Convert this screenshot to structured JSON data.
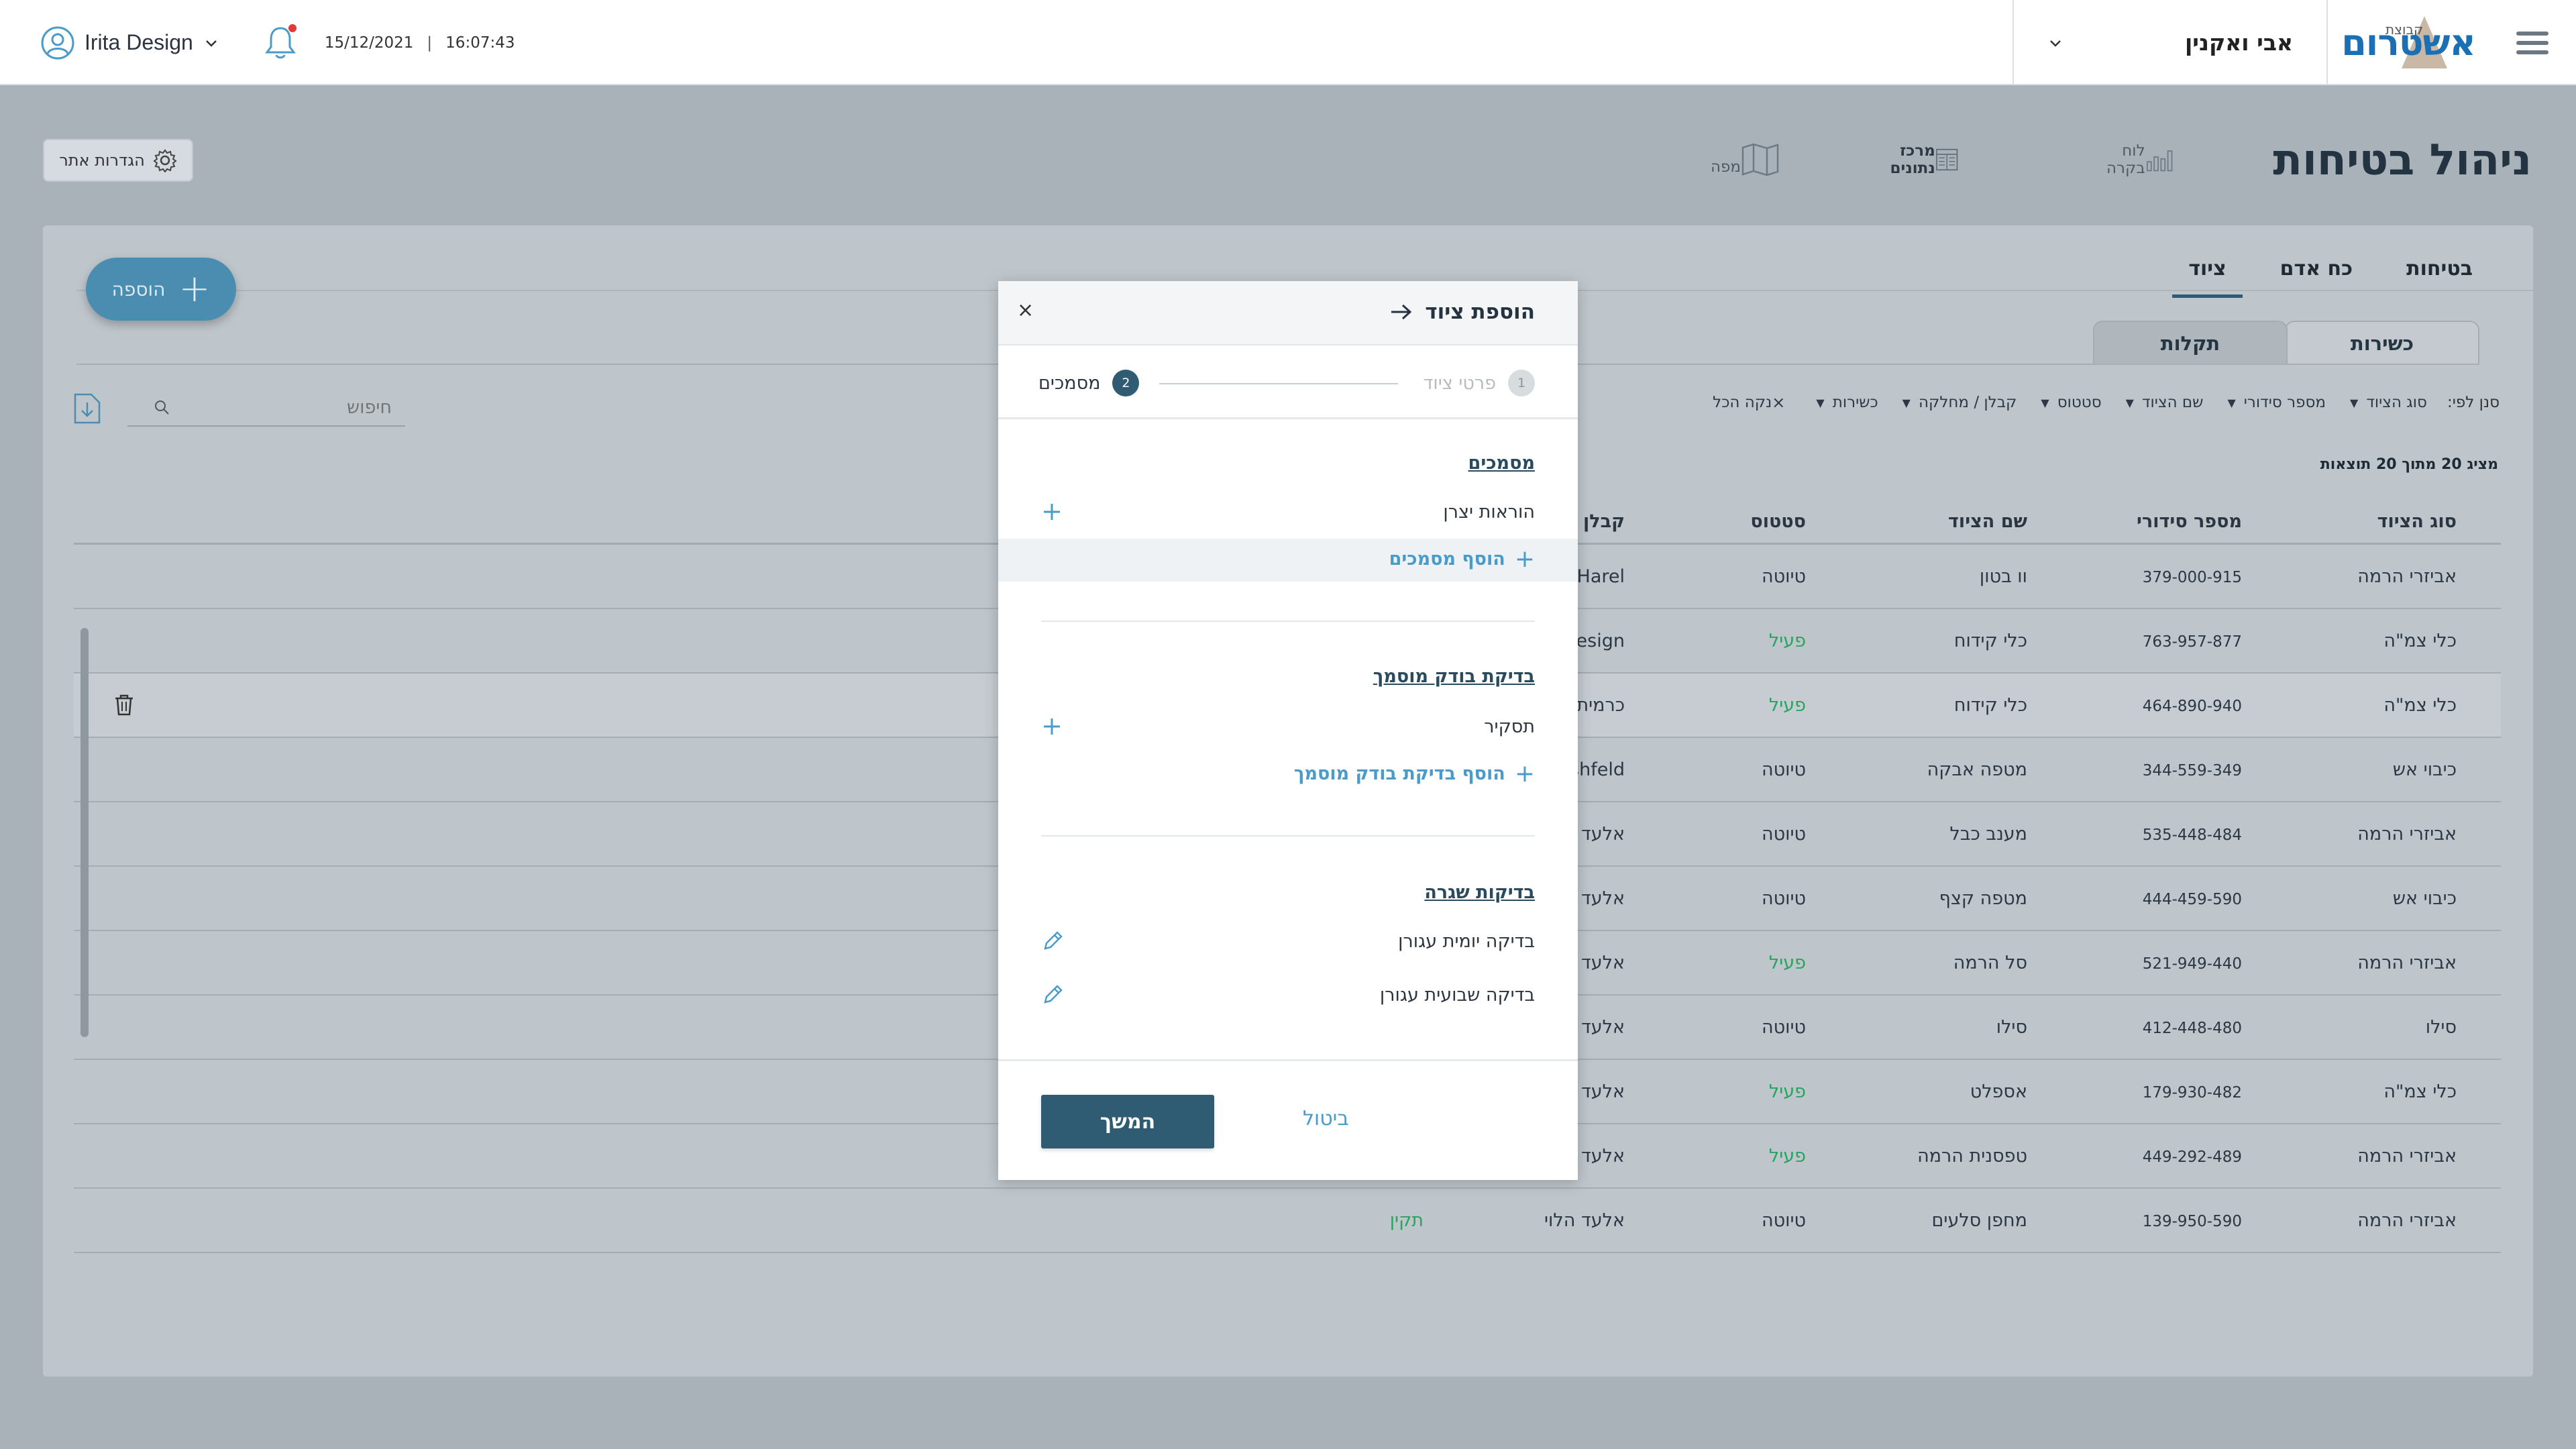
{
  "topbar": {
    "user_name": "Irita Design",
    "date": "15/12/2021",
    "separator": "|",
    "time": "16:07:43",
    "company_name": "אבי ואקנין",
    "logo_small": "קבוצת",
    "logo_text": "אשטרום"
  },
  "page": {
    "title": "ניהול בטיחות",
    "views": {
      "dashboard": "לוח בקרה",
      "data_center": "מרכז נתונים",
      "map": "מפה"
    },
    "site_settings": "הגדרות אתר"
  },
  "tabs": [
    "בטיחות",
    "כח אדם",
    "ציוד"
  ],
  "subtabs": [
    "כשירות",
    "תקלות"
  ],
  "add_button": "הוספה",
  "filter": {
    "label": "סנן לפי:",
    "items": [
      "סוג הציוד",
      "מספר סידורי",
      "שם הציוד",
      "סטטוס",
      "קבלן / מחלקה",
      "כשירות"
    ],
    "clear": "נקה הכל"
  },
  "search": {
    "placeholder": "חיפוש"
  },
  "results_count": "מציג 20 מתוך 20 תוצאות",
  "table": {
    "headers": [
      "סוג הציוד",
      "מספר סידורי",
      "שם הציוד",
      "סטטוס",
      "קבלן / מ"
    ],
    "rows": [
      {
        "type": "אביזרי הרמה",
        "serial": "379-000-915",
        "name": "וו בטון",
        "status": "טיוטה",
        "contractor": "Harel",
        "status_green": false
      },
      {
        "type": "כלי צמ\"ה",
        "serial": "763-957-877",
        "name": "כלי קידוח",
        "status": "פעיל",
        "contractor": "Design",
        "status_green": true
      },
      {
        "type": "כלי צמ\"ה",
        "serial": "464-890-940",
        "name": "כלי קידוח",
        "status": "פעיל",
        "contractor": "כרמית",
        "status_green": true
      },
      {
        "type": "כיבוי אש",
        "serial": "344-559-349",
        "name": "מטפה אבקה",
        "status": "טיוטה",
        "contractor": "shfeld",
        "status_green": false
      },
      {
        "type": "אביזרי הרמה",
        "serial": "535-448-484",
        "name": "מענב כבל",
        "status": "טיוטה",
        "contractor": "אלעד",
        "status_green": false
      },
      {
        "type": "כיבוי אש",
        "serial": "444-459-590",
        "name": "מטפה קצף",
        "status": "טיוטה",
        "contractor": "אלעד",
        "status_green": false
      },
      {
        "type": "אביזרי הרמה",
        "serial": "521-949-440",
        "name": "סל הרמה",
        "status": "פעיל",
        "contractor": "אלעד",
        "status_green": true
      },
      {
        "type": "סילו",
        "serial": "412-448-480",
        "name": "סילו",
        "status": "טיוטה",
        "contractor": "אלעד",
        "status_green": false
      },
      {
        "type": "כלי צמ\"ה",
        "serial": "179-930-482",
        "name": "אספלט",
        "status": "פעיל",
        "contractor": "אלעד",
        "status_green": true
      },
      {
        "type": "אביזרי הרמה",
        "serial": "449-292-489",
        "name": "טפסנית הרמה",
        "status": "פעיל",
        "contractor": "אלעד",
        "status_green": true
      },
      {
        "type": "אביזרי הרמה",
        "serial": "139-950-590",
        "name": "מחפן סלעים",
        "status": "טיוטה",
        "contractor": "אלעד הלוי",
        "status_green": false,
        "extra": "תקין"
      }
    ]
  },
  "modal": {
    "title": "הוספת ציוד",
    "close": "×",
    "step1_num": "1",
    "step1_label": "פרטי ציוד",
    "step2_num": "2",
    "step2_label": "מסמכים",
    "sec_docs": "מסמכים",
    "doc_item": "הוראות יצרן",
    "add_docs": "הוסף מסמכים",
    "sec_inspection": "בדיקת בודק מוסמך",
    "inspection_item": "תסקיר",
    "add_inspection": "הוסף בדיקת בודק מוסמך",
    "sec_routine": "בדיקות שגרה",
    "routine_items": [
      "בדיקה יומית עגורן",
      "בדיקה שבועית עגורן"
    ],
    "next": "המשך",
    "cancel": "ביטול"
  },
  "colors": {
    "accent": "#2f5b73",
    "link": "#4a9bc9",
    "active_green": "#26a460",
    "overlay_bg": "#a9b2b9"
  }
}
